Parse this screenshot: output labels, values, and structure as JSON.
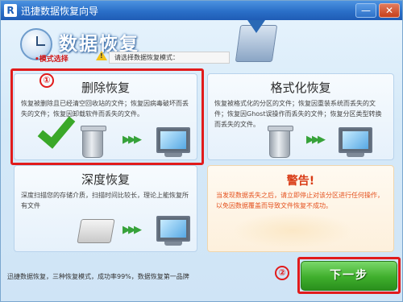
{
  "window": {
    "icon_letter": "R",
    "title": "迅捷数据恢复向导",
    "minimize_label": "—",
    "close_label": "✕"
  },
  "header": {
    "app_title": "数据恢复",
    "mode_label": "•模式选择",
    "hint": "请选择数据恢复模式："
  },
  "cards": {
    "delete": {
      "title": "删除恢复",
      "desc": "恢复被删除且已经清空回收站的文件；恢复因病毒破坏而丢失的文件；恢复因卸载软件而丢失的文件。"
    },
    "format": {
      "title": "格式化恢复",
      "desc": "恢复被格式化的分区的文件；恢复因重装系统而丢失的文件；恢复因Ghost误操作而丢失的文件；恢复分区类型转换而丢失的文件。"
    },
    "deep": {
      "title": "深度恢复",
      "desc": "深度扫描您的存储介质，扫描时间比较长，理论上能恢复所有文件"
    },
    "warning": {
      "title": "警告!",
      "text": "当发现数据丢失之后，请立即停止对该分区进行任何操作，以免因数据覆盖而导致文件恢复不成功。"
    }
  },
  "annotations": {
    "one": "①",
    "two": "②"
  },
  "footer": {
    "text": "迅捷数据恢复，三种恢复模式，成功率99%，数据恢复第一品牌"
  },
  "next_button": {
    "label": "下一步"
  },
  "colors": {
    "accent_blue": "#2a6fc8",
    "highlight_red": "#e11b1b",
    "next_green": "#3fae2c",
    "warning_orange": "#d93a14"
  }
}
